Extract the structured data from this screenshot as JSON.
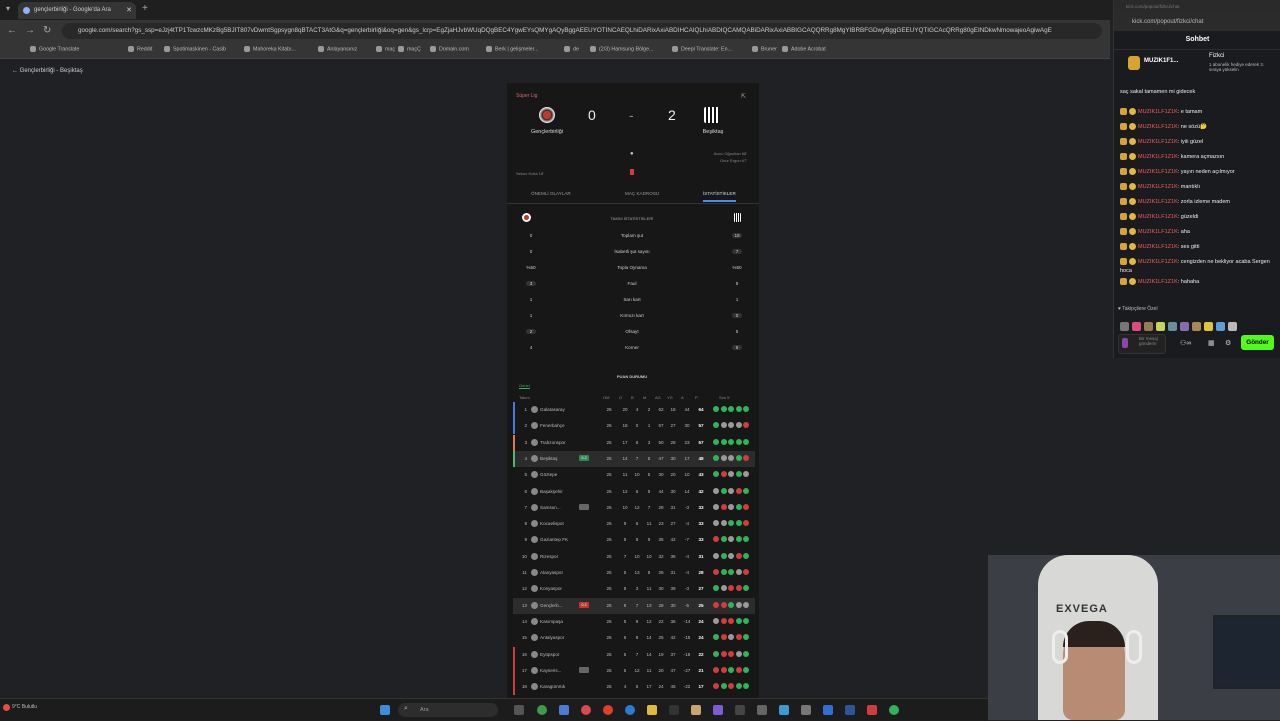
{
  "browser": {
    "tab_title": "gençlerbirliği - Google'da Ara",
    "new_tab": "+",
    "url": "google.com/search?gs_ssp=eJzj4tTP1TcwzcMKzBg5BJIT807vDwmtSgpsygn8qBTACT3AtG&q=gençlerbirliği&oq=gen&gs_lcrp=EgZjaHJvbWUqDQgBEC4YgwEYsQMYgAQyBggAEEUYOTINCAEQLhiDARixAxiABDIHCAIQLhiABDIQCAMQABiDARixAxiABBIGCAQQRRg8MgYIBRBFGDwyBggGEEUYQTIGCAcQRRg80gEINDkwNmowajeoAgiwAgE",
    "bookmarks": [
      "Google Translate",
      "Reddit",
      "Spotimaskinen - Casib",
      "Mahoreka Kitabı...",
      "Anlayansınız",
      "maç",
      "maçÇ",
      "Domain.com",
      "Berk | gelişmeler...",
      "de",
      "(2/3) Hamsung Bölge...",
      "Deepl Translate: En...",
      "Bruner",
      "Adobe Acrobat"
    ],
    "back_label": "Gençlerbirliği - Beşiktaş"
  },
  "match": {
    "league": "Süper Lig",
    "home_team": "Gençlerbirliği",
    "away_team": "Beşiktaş",
    "home_score": "0",
    "away_score": "2",
    "separator": "-",
    "scorer_info_1": "Avcıc Oğuzhan 68'",
    "scorer_info_2": "Onur Ergun 67'",
    "card_info": "Sekou Koita 18'",
    "tabs": [
      "ÖNEMLİ OLAYLAR",
      "MAÇ KADROSU",
      "İSTATİSTİKLER"
    ],
    "stats_title": "TAKIM İSTATİSTİKLERİ",
    "stats": [
      {
        "home": "0",
        "label": "Toplam şut",
        "away": "19"
      },
      {
        "home": "0",
        "label": "İsabetli şut sayısı",
        "away": "7"
      },
      {
        "home": "%50",
        "label": "Topla Oynama",
        "away": "%50"
      },
      {
        "home": "3",
        "label": "Faul",
        "away": "8"
      },
      {
        "home": "1",
        "label": "Sarı kart",
        "away": "1"
      },
      {
        "home": "1",
        "label": "Kırmızı kart",
        "away": "0"
      },
      {
        "home": "2",
        "label": "Ofsayt",
        "away": "5"
      },
      {
        "home": "4",
        "label": "Korner",
        "away": "8"
      }
    ],
    "standings_title": "PUAN DURUMU",
    "standings_tab": "Genel",
    "standings_headers": [
      "Takım",
      "OM",
      "G",
      "B",
      "M",
      "AG",
      "YG",
      "A",
      "P",
      "Son 5"
    ]
  },
  "standings": [
    {
      "pos": "1",
      "team": "Galatasaray",
      "om": "26",
      "g": "20",
      "b": "4",
      "m": "2",
      "ag": "62",
      "yg": "18",
      "a": "44",
      "p": "64",
      "bar": "#3d7be0",
      "form": [
        "w",
        "w",
        "w",
        "w",
        "w"
      ]
    },
    {
      "pos": "2",
      "team": "Fenerbahçe",
      "om": "26",
      "g": "18",
      "b": "0",
      "m": "1",
      "ag": "57",
      "yg": "27",
      "a": "30",
      "p": "57",
      "bar": "#3d7be0",
      "form": [
        "w",
        "d",
        "d",
        "d",
        "l"
      ]
    },
    {
      "pos": "3",
      "team": "Trabzonspor",
      "om": "26",
      "g": "17",
      "b": "6",
      "m": "3",
      "ag": "50",
      "yg": "28",
      "a": "23",
      "p": "57",
      "bar": "#e07b3d",
      "form": [
        "w",
        "w",
        "w",
        "w",
        "w"
      ]
    },
    {
      "pos": "4",
      "team": "Beşiktaş",
      "om": "26",
      "g": "14",
      "b": "7",
      "m": "5",
      "ag": "47",
      "yg": "30",
      "a": "17",
      "p": "48",
      "bar": "#3dbf6b",
      "badge": "0-2",
      "badgeColor": "#2e8b57",
      "hl": true,
      "form": [
        "w",
        "d",
        "d",
        "w",
        "l"
      ]
    },
    {
      "pos": "5",
      "team": "Göztepe",
      "om": "26",
      "g": "11",
      "b": "10",
      "m": "5",
      "ag": "30",
      "yg": "20",
      "a": "10",
      "p": "43",
      "bar": "",
      "form": [
        "w",
        "l",
        "d",
        "w",
        "d"
      ]
    },
    {
      "pos": "6",
      "team": "Başakşehir",
      "om": "26",
      "g": "12",
      "b": "6",
      "m": "8",
      "ag": "44",
      "yg": "30",
      "a": "14",
      "p": "42",
      "bar": "",
      "form": [
        "d",
        "w",
        "d",
        "l",
        "w"
      ]
    },
    {
      "pos": "7",
      "team": "Samsun...",
      "om": "26",
      "g": "10",
      "b": "12",
      "m": "7",
      "ag": "28",
      "yg": "31",
      "a": "-3",
      "p": "33",
      "bar": "",
      "badge": "",
      "badgeColor": "#666",
      "form": [
        "d",
        "l",
        "d",
        "w",
        "l"
      ]
    },
    {
      "pos": "8",
      "team": "Kocaelispor",
      "om": "26",
      "g": "9",
      "b": "6",
      "m": "11",
      "ag": "23",
      "yg": "27",
      "a": "-4",
      "p": "33",
      "bar": "",
      "form": [
        "d",
        "d",
        "w",
        "w",
        "l"
      ]
    },
    {
      "pos": "9",
      "team": "Gaziantep FK",
      "om": "26",
      "g": "8",
      "b": "9",
      "m": "9",
      "ag": "35",
      "yg": "42",
      "a": "-7",
      "p": "33",
      "bar": "",
      "form": [
        "l",
        "w",
        "d",
        "w",
        "w"
      ]
    },
    {
      "pos": "10",
      "team": "Rizespor",
      "om": "26",
      "g": "7",
      "b": "10",
      "m": "10",
      "ag": "32",
      "yg": "36",
      "a": "-4",
      "p": "31",
      "bar": "",
      "form": [
        "d",
        "w",
        "d",
        "l",
        "w"
      ]
    },
    {
      "pos": "11",
      "team": "Alanyaspor",
      "om": "26",
      "g": "5",
      "b": "13",
      "m": "8",
      "ag": "28",
      "yg": "31",
      "a": "-4",
      "p": "28",
      "bar": "",
      "form": [
        "l",
        "w",
        "w",
        "d",
        "l"
      ]
    },
    {
      "pos": "12",
      "team": "Konyaspor",
      "om": "26",
      "g": "8",
      "b": "3",
      "m": "11",
      "ag": "30",
      "yg": "39",
      "a": "-3",
      "p": "27",
      "bar": "",
      "form": [
        "w",
        "d",
        "l",
        "l",
        "w"
      ]
    },
    {
      "pos": "13",
      "team": "Gençlerb...",
      "om": "26",
      "g": "8",
      "b": "7",
      "m": "13",
      "ag": "28",
      "yg": "30",
      "a": "-5",
      "p": "25",
      "bar": "",
      "badge": "0-2",
      "badgeColor": "#c0392b",
      "hl": true,
      "form": [
        "l",
        "l",
        "w",
        "d",
        "d"
      ]
    },
    {
      "pos": "14",
      "team": "Kasımpaşa",
      "om": "26",
      "g": "5",
      "b": "9",
      "m": "12",
      "ag": "22",
      "yg": "36",
      "a": "-14",
      "p": "24",
      "bar": "",
      "form": [
        "d",
        "l",
        "l",
        "w",
        "w"
      ]
    },
    {
      "pos": "15",
      "team": "Antalyaspor",
      "om": "26",
      "g": "6",
      "b": "8",
      "m": "14",
      "ag": "25",
      "yg": "42",
      "a": "-15",
      "p": "24",
      "bar": "",
      "form": [
        "w",
        "l",
        "d",
        "l",
        "w"
      ]
    },
    {
      "pos": "16",
      "team": "Eyüpspor",
      "om": "26",
      "g": "5",
      "b": "7",
      "m": "14",
      "ag": "19",
      "yg": "37",
      "a": "-18",
      "p": "22",
      "bar": "#d23c3c",
      "form": [
        "w",
        "l",
        "l",
        "d",
        "w"
      ]
    },
    {
      "pos": "17",
      "team": "Kayseris...",
      "om": "26",
      "g": "5",
      "b": "12",
      "m": "11",
      "ag": "20",
      "yg": "47",
      "a": "-27",
      "p": "21",
      "bar": "#d23c3c",
      "badge": "",
      "badgeColor": "#666",
      "form": [
        "l",
        "l",
        "w",
        "l",
        "w"
      ]
    },
    {
      "pos": "18",
      "team": "Karagümrük",
      "om": "26",
      "g": "4",
      "b": "5",
      "m": "17",
      "ag": "24",
      "yg": "46",
      "a": "-22",
      "p": "17",
      "bar": "#d23c3c",
      "form": [
        "l",
        "w",
        "l",
        "w",
        "w"
      ]
    }
  ],
  "chat": {
    "top_url": "kick.com/popout/fizkci/chat",
    "url": "kick.com/popout/fizkci/chat",
    "title": "Sohbet",
    "pinned_user": "MUZIK1F1...",
    "pinned_streamer": "Fizkci",
    "pinned_note": "1 abonelik hediye ederek 3. sıraya yükselin",
    "messages": [
      {
        "user": "",
        "text": "saç sakal tamamen mi gidecek"
      },
      {
        "user": "MUZIK1LF1Z1K",
        "text": ": e tamam"
      },
      {
        "user": "MUZIK1LF1Z1K",
        "text": ": ne sözü🤔"
      },
      {
        "user": "MUZIK1LF1Z1K",
        "text": ": iyiii güzel"
      },
      {
        "user": "MUZIK1LF1Z1K",
        "text": ": kamera açmazsın"
      },
      {
        "user": "MUZIK1LF1Z1K",
        "text": ": yayın neden açılmıyor"
      },
      {
        "user": "MUZIK1LF1Z1K",
        "text": ": mantıklı"
      },
      {
        "user": "MUZIK1LF1Z1K",
        "text": ": zorla izleme madem"
      },
      {
        "user": "MUZIK1LF1Z1K",
        "text": ": güzeldi"
      },
      {
        "user": "MUZIK1LF1Z1K",
        "text": ": aha"
      },
      {
        "user": "MUZIK1LF1Z1K",
        "text": ": ses gitti"
      },
      {
        "user": "MUZIK1LF1Z1K",
        "text": ": cengizden ne bekliyor acaba Sergen hoca"
      },
      {
        "user": "MUZIK1LF1Z1K",
        "text": ": hahaha"
      }
    ],
    "emotes_label": "♥ Takipçilere Özel",
    "input_placeholder": "Bir mesaj gönderin",
    "send_label": "Gönder"
  },
  "taskbar": {
    "weather": "9°C Bulutlu",
    "search_placeholder": "Ara"
  },
  "colors": {
    "win": "#2fb45a",
    "draw": "#9a9a9a",
    "loss": "#d23c3c",
    "kick_green": "#53fc18"
  }
}
